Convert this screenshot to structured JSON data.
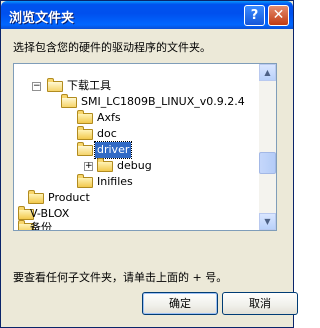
{
  "window": {
    "title": "浏览文件夹",
    "help_label": "?",
    "close_label": "✕"
  },
  "instruction": "选择包含您的硬件的驱动程序的文件夹。",
  "tree": {
    "items": [
      {
        "label": "下载工具",
        "expander": "−"
      },
      {
        "label": "SMI_LC1809B_LINUX_v0.9.2.4",
        "expander": ""
      },
      {
        "label": "Axfs",
        "expander": ""
      },
      {
        "label": "doc",
        "expander": ""
      },
      {
        "label": "driver",
        "expander": "",
        "selected": true
      },
      {
        "label": "debug",
        "expander": "+"
      },
      {
        "label": "Inifiles",
        "expander": ""
      },
      {
        "label": "Product",
        "expander": ""
      },
      {
        "label": "V-BLOX",
        "expander": ""
      },
      {
        "label": "备份",
        "expander": ""
      }
    ],
    "scroll_up": "▲",
    "scroll_down": "▼"
  },
  "hint": "要查看任何子文件夹，请单击上面的 + 号。",
  "buttons": {
    "ok": "确定",
    "cancel": "取消"
  }
}
